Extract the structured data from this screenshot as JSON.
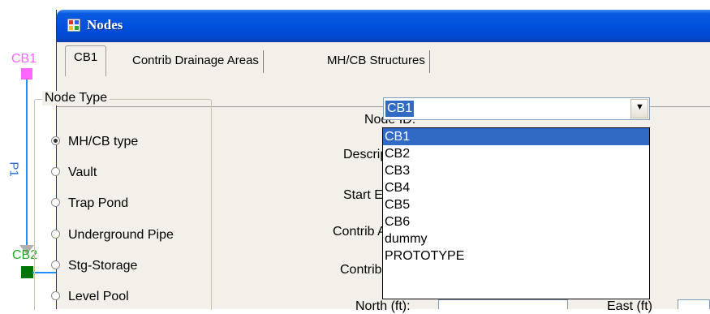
{
  "canvas": {
    "node_top_label": "CB1",
    "node_bottom_label": "CB2",
    "link_label": "P1",
    "colors": {
      "node_top": "#ff66ff",
      "node_bottom": "#007700",
      "link": "#1e6fe0"
    }
  },
  "window": {
    "title": "Nodes",
    "tabs": [
      {
        "label": "CB1"
      },
      {
        "label": "Contrib Drainage Areas"
      },
      {
        "label": "MH/CB Structures"
      }
    ]
  },
  "node_type": {
    "group_title": "Node Type",
    "options": [
      {
        "label": "MH/CB type",
        "checked": true
      },
      {
        "label": "Vault",
        "checked": false
      },
      {
        "label": "Trap Pond",
        "checked": false
      },
      {
        "label": "Underground Pipe",
        "checked": false
      },
      {
        "label": "Stg-Storage",
        "checked": false
      },
      {
        "label": "Level Pool",
        "checked": false
      }
    ]
  },
  "fields": {
    "node_id_label": "Node ID:",
    "description_label": "Description:",
    "start_el_label": "Start EL(ft):",
    "contrib_area_label": "Contrib Area:",
    "contrib_hyd_label": "Contrib Hyd:",
    "north_label": "North (ft):",
    "east_label": "East (ft)"
  },
  "node_id_combo": {
    "value": "CB1",
    "options": [
      "CB1",
      "CB2",
      "CB3",
      "CB4",
      "CB5",
      "CB6",
      "dummy",
      "PROTOTYPE"
    ],
    "selected_index": 0
  }
}
